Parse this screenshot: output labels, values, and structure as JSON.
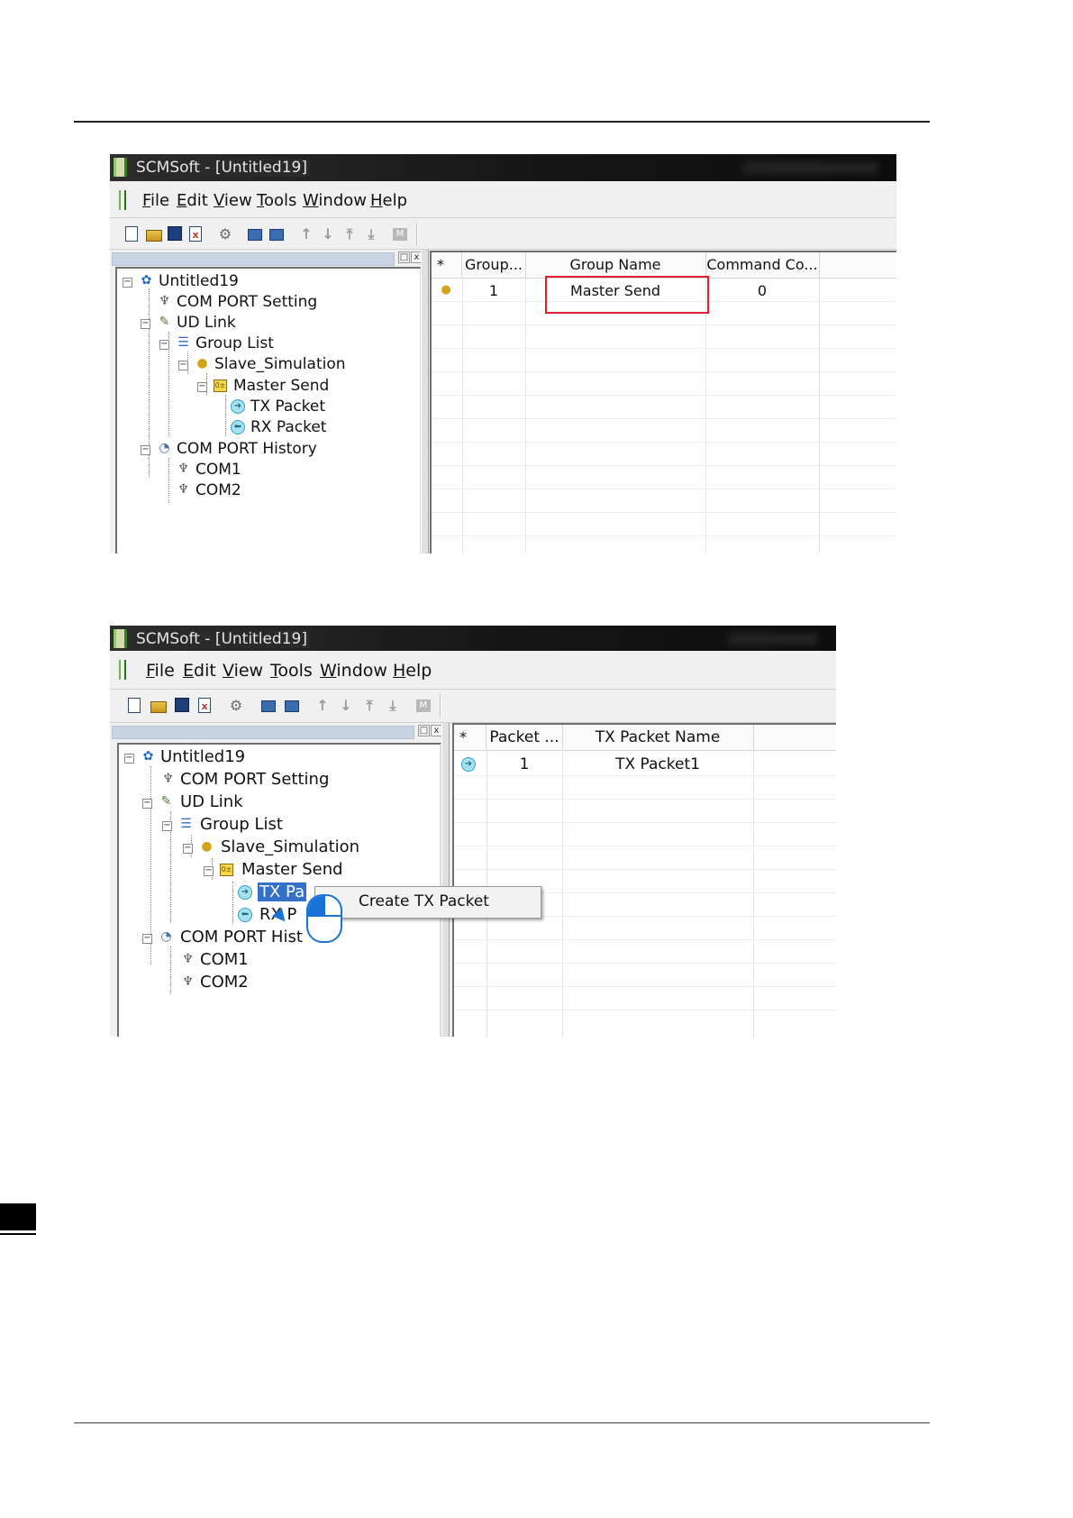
{
  "window_title": "SCMSoft - [Untitled19]",
  "menu": [
    "File",
    "Edit",
    "View",
    "Tools",
    "Window",
    "Help"
  ],
  "toolbar_icons": [
    "new-file-icon",
    "open-folder-icon",
    "save-disk-icon",
    "delete-file-icon",
    "settings-gear-icon",
    "network-send-icon",
    "network-receive-icon",
    "move-up-icon",
    "move-down-icon",
    "move-top-icon",
    "move-bottom-icon",
    "monitor-icon"
  ],
  "pane_buttons": {
    "restore": "□",
    "close": "x"
  },
  "tree": {
    "root": "Untitled19",
    "com_port_setting": "COM PORT Setting",
    "ud_link": "UD Link",
    "group_list": "Group List",
    "slave_simulation": "Slave_Simulation",
    "master_send": "Master Send",
    "tx_packet": "TX Packet",
    "rx_packet": "RX Packet",
    "com_port_history": "COM PORT History",
    "com1": "COM1",
    "com2": "COM2",
    "tx_packet_partial": "TX Pa",
    "rx_packet_partial": "RX P",
    "com_port_history_partial": "COM PORT Hist"
  },
  "grid1": {
    "headers": [
      "*",
      "Group...",
      "Group Name",
      "Command Co..."
    ],
    "rows": [
      {
        "group": "1",
        "group_name": "Master Send",
        "command_count": "0"
      }
    ]
  },
  "grid2": {
    "headers": [
      "*",
      "Packet ...",
      "TX Packet Name"
    ],
    "rows": [
      {
        "packet": "1",
        "tx_packet_name": "TX Packet1"
      }
    ]
  },
  "context_menu": {
    "items": [
      "Create TX Packet"
    ]
  },
  "colors": {
    "highlight_box": "#e0202c",
    "selection": "#3470c8",
    "cursor": "#1a72d8"
  }
}
